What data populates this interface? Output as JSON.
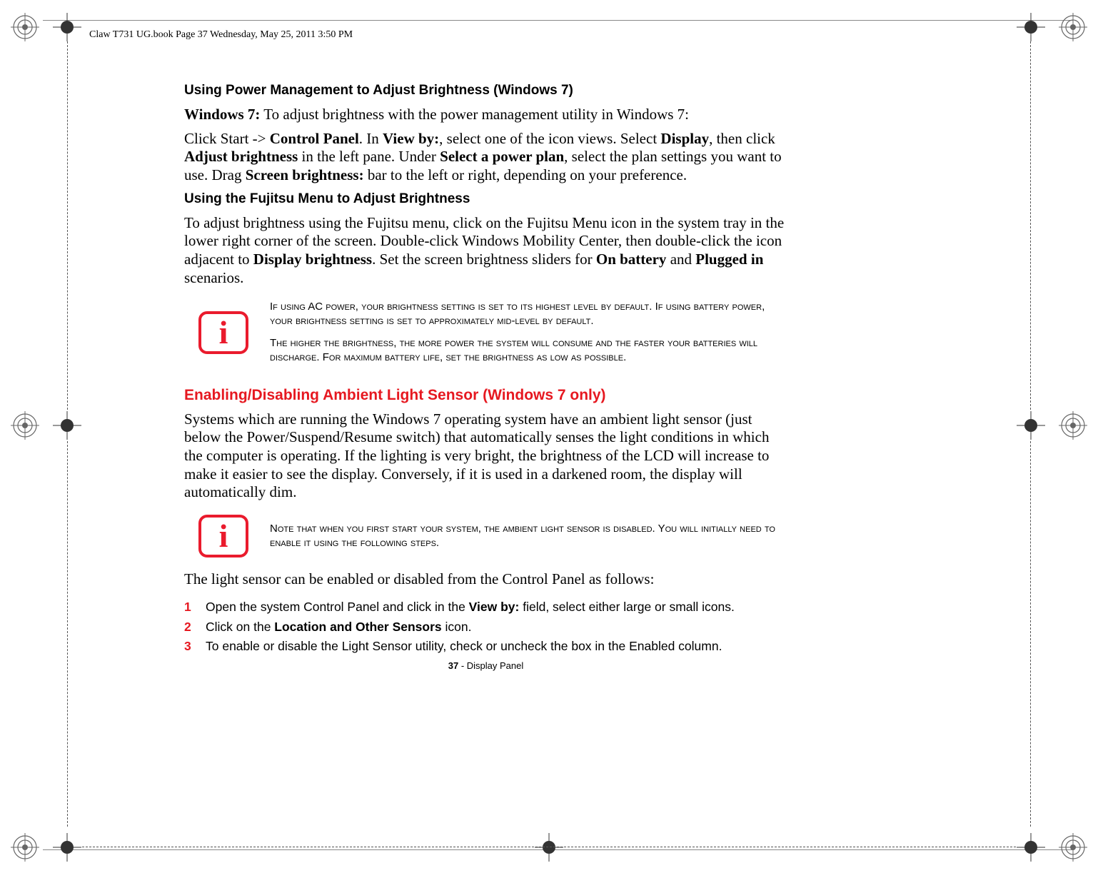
{
  "meta": {
    "running_header": "Claw T731 UG.book  Page 37  Wednesday, May 25, 2011  3:50 PM"
  },
  "s1": {
    "heading": "Using Power Management to Adjust Brightness (Windows 7)",
    "p1_a": "Windows 7:",
    "p1_b": " To adjust brightness with the power management utility in Windows 7:",
    "p2_a": "Click Start -> ",
    "p2_b": "Control Panel",
    "p2_c": ". In ",
    "p2_d": "View by:",
    "p2_e": ", select one of the icon views. Select ",
    "p2_f": "Display",
    "p2_g": ", then click ",
    "p2_h": "Adjust brightness",
    "p2_i": " in the left pane. Under ",
    "p2_j": "Select a power plan",
    "p2_k": ", select the plan settings you want to use. Drag ",
    "p2_l": "Screen brightness:",
    "p2_m": " bar to the left or right, depending on your preference."
  },
  "s2": {
    "heading": "Using the Fujitsu Menu to Adjust Brightness",
    "p1_a": "To adjust brightness using the Fujitsu menu, click on the Fujitsu Menu icon in the system tray in the lower right corner of the screen. Double-click Windows Mobility Center, then double-click the icon adjacent to ",
    "p1_b": "Display brightness",
    "p1_c": ". Set the screen brightness sliders for ",
    "p1_d": "On battery",
    "p1_e": " and ",
    "p1_f": "Plugged in",
    "p1_g": " scenarios."
  },
  "note1": {
    "glyph": "i",
    "p1": "If using AC power, your brightness setting is set to its highest level by default. If using battery power, your brightness setting is set to approximately mid-level by default.",
    "p2": "The higher the brightness, the more power the system will consume and the faster your batteries will discharge. For maximum battery life, set the brightness as low as possible."
  },
  "s3": {
    "heading": "Enabling/Disabling Ambient Light Sensor (Windows 7 only)",
    "p1": "Systems which are running the Windows 7 operating system have an ambient light sensor (just below the Power/Suspend/Resume switch) that automatically senses the light conditions in which the computer is operating. If the lighting is very bright, the brightness of the LCD will increase to make it easier to see the display. Conversely, if it is used in a darkened room, the display will automatically dim."
  },
  "note2": {
    "glyph": "i",
    "p1": "Note that when you first start your system, the ambient light sensor is disabled. You will initially need to enable it using the following steps."
  },
  "s4": {
    "p1": "The light sensor can be enabled or disabled from the Control Panel as follows:"
  },
  "steps": {
    "n1": "1",
    "t1_a": "Open the system Control Panel and click in the ",
    "t1_b": "View by:",
    "t1_c": " field, select either large or small icons.",
    "n2": "2",
    "t2_a": "Click on the ",
    "t2_b": "Location and Other Sensors",
    "t2_c": " icon.",
    "n3": "3",
    "t3": "To enable or disable the Light Sensor utility, check or uncheck the box in the Enabled column."
  },
  "footer": {
    "page": "37",
    "label": " - Display Panel"
  }
}
